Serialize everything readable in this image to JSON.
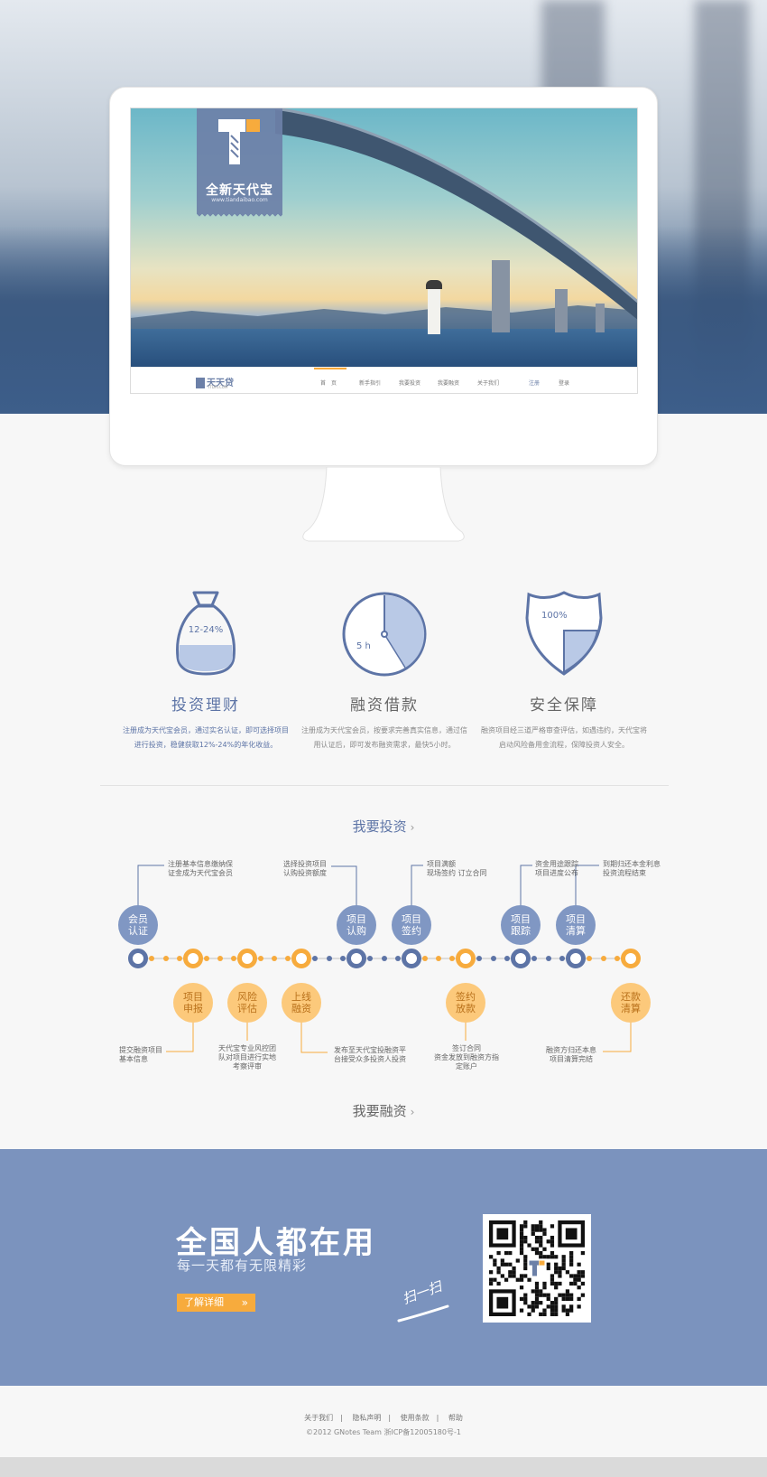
{
  "hero": {
    "badge_title": "全新天代宝",
    "badge_url": "www.tiandaibao.com",
    "site_logo": "天天贷",
    "site_logo_sub": "TTDAI.COM",
    "nav": [
      "首　页",
      "新手指引",
      "我要投资",
      "我要融资",
      "关于我们"
    ],
    "nav_right": [
      "注册",
      "登录"
    ]
  },
  "features": [
    {
      "title": "投资理财",
      "desc": "注册成为天代宝会员，通过实名认证，即可选择项目进行投资，稳健获取12%-24%的年化收益。",
      "icon": "money-bag-icon",
      "icon_label": "12-24%"
    },
    {
      "title": "融资借款",
      "desc": "注册成为天代宝会员，按要求完善真实信息，通过信用认证后，即可发布融资需求，最快5小时。",
      "icon": "clock-icon",
      "icon_label": "5 h"
    },
    {
      "title": "安全保障",
      "desc": "融资项目经三道严格审查评估，如遇违约，天代宝将启动风险备用金流程，保障投资人安全。",
      "icon": "shield-icon",
      "icon_label": "100%"
    }
  ],
  "invest_link": "我要投资",
  "finance_link": "我要融资",
  "timeline": {
    "top_bubbles": [
      {
        "label_1": "会员",
        "label_2": "认证"
      },
      {
        "label_1": "项目",
        "label_2": "认购"
      },
      {
        "label_1": "项目",
        "label_2": "签约"
      },
      {
        "label_1": "项目",
        "label_2": "跟踪"
      },
      {
        "label_1": "项目",
        "label_2": "清算"
      }
    ],
    "bottom_bubbles": [
      {
        "label_1": "项目",
        "label_2": "申报"
      },
      {
        "label_1": "风险",
        "label_2": "评估"
      },
      {
        "label_1": "上线",
        "label_2": "融资"
      },
      {
        "label_1": "签约",
        "label_2": "放款"
      },
      {
        "label_1": "还款",
        "label_2": "清算"
      }
    ],
    "top_notes": [
      {
        "line_1": "注册基本信息缴纳保",
        "line_2": "证金成为天代宝会员"
      },
      {
        "line_1": "选择投资项目",
        "line_2": "认购投资额度"
      },
      {
        "line_1": "项目满额",
        "line_2": "现场签约 订立合同"
      },
      {
        "line_1": "资金用途跟踪",
        "line_2": "项目进度公布"
      },
      {
        "line_1": "到期归还本金利息",
        "line_2": "投资流程结束"
      }
    ],
    "bottom_notes": [
      {
        "line_1": "提交融资项目",
        "line_2": "基本信息",
        "line_3": ""
      },
      {
        "line_1": "天代宝专业风控团",
        "line_2": "队对项目进行实地",
        "line_3": "考察评审"
      },
      {
        "line_1": "发布至天代宝投融资平",
        "line_2": "台接受众多投资人投资",
        "line_3": ""
      },
      {
        "line_1": "签订合同",
        "line_2": "资金发放到融资方指",
        "line_3": "定账户"
      },
      {
        "line_1": "融资方归还本息",
        "line_2": "项目清算完结",
        "line_3": ""
      }
    ]
  },
  "promo": {
    "title": "全国人都在用",
    "subtitle": "每一天都有无限精彩",
    "button": "了解详细",
    "scan": "扫一扫"
  },
  "footer": {
    "links": [
      "关于我们",
      "隐私声明",
      "使用条款",
      "帮助"
    ],
    "copyright": "©2012 GNotes Team 浙ICP备12005180号-1"
  },
  "colors": {
    "brand_blue": "#5d74a6",
    "accent_orange": "#f7ab3d",
    "promo_bg": "#7b93be"
  }
}
